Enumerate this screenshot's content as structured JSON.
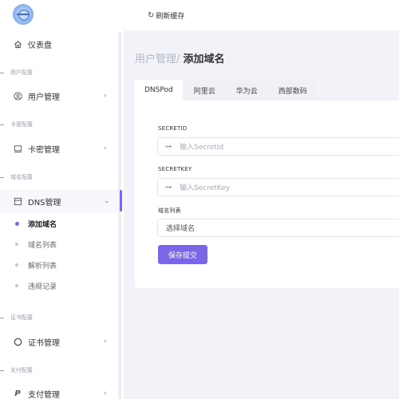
{
  "topbar": {
    "refresh_label": "刷新缓存"
  },
  "page": {
    "breadcrumb": "用户管理/",
    "title": "添加域名"
  },
  "sidebar": {
    "dashboard": "仪表盘",
    "sections": {
      "user": "用户配置",
      "card": "卡密配置",
      "domain": "域名配置",
      "cert": "证书配置",
      "pay": "支付配置"
    },
    "items": {
      "user_manage": "用户管理",
      "card_manage": "卡密管理",
      "dns_manage": "DNS管理",
      "cert_manage": "证书管理",
      "pay_manage": "支付管理"
    },
    "dns_sub": [
      "添加域名",
      "域名列表",
      "解析列表",
      "违规记录"
    ]
  },
  "tabs": [
    "DNSPod",
    "阿里云",
    "华为云",
    "西部数码"
  ],
  "form": {
    "secretid_label": "SECRETID",
    "secretid_placeholder": "输入SecretId",
    "secretkey_label": "SECRETKEY",
    "secretkey_placeholder": "输入SecretKey",
    "domain_list_label": "域名列表",
    "domain_select_value": "选择域名",
    "submit_label": "保存提交"
  },
  "colors": {
    "accent": "#7a67e8",
    "background": "#f2f3f8"
  }
}
